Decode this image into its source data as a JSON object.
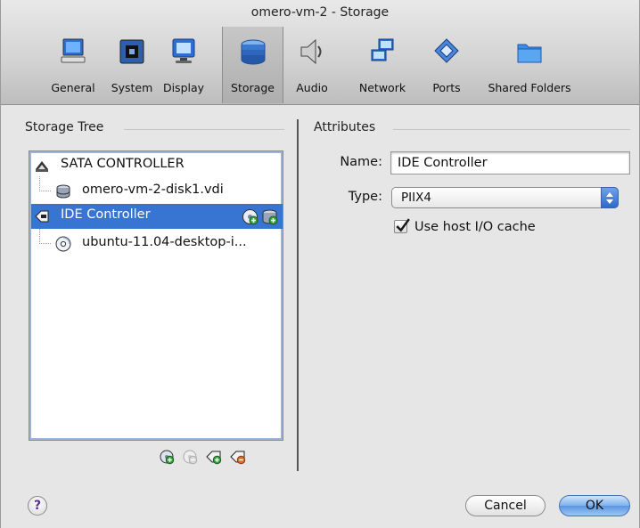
{
  "window": {
    "title": "omero-vm-2 - Storage"
  },
  "toolbar": {
    "items": [
      {
        "label": "General",
        "icon": "monitor-icon"
      },
      {
        "label": "System",
        "icon": "chip-icon"
      },
      {
        "label": "Display",
        "icon": "display-icon"
      },
      {
        "label": "Storage",
        "icon": "disk-stack-icon",
        "selected": true
      },
      {
        "label": "Audio",
        "icon": "speaker-icon"
      },
      {
        "label": "Network",
        "icon": "network-icon"
      },
      {
        "label": "Ports",
        "icon": "ports-icon"
      },
      {
        "label": "Shared Folders",
        "icon": "folder-icon"
      }
    ]
  },
  "storage": {
    "header": "Storage Tree",
    "tree": [
      {
        "label": "SATA CONTROLLER",
        "icon": "sata-controller-icon",
        "level": 0
      },
      {
        "label": "omero-vm-2-disk1.vdi",
        "icon": "hard-disk-icon",
        "level": 1
      },
      {
        "label": "IDE Controller",
        "icon": "ide-controller-icon",
        "level": 0,
        "selected": true
      },
      {
        "label": "ubuntu-11.04-desktop-i...",
        "icon": "cd-icon",
        "level": 1
      }
    ]
  },
  "attributes": {
    "header": "Attributes",
    "name_label": "Name:",
    "name_value": "IDE Controller",
    "type_label": "Type:",
    "type_value": "PIIX4",
    "cache_label": "Use host I/O cache",
    "cache_checked": true
  },
  "buttons": {
    "help": "?",
    "cancel": "Cancel",
    "ok": "OK"
  },
  "colors": {
    "selection": "#3874d1",
    "ok_button": "#5b96e0"
  }
}
